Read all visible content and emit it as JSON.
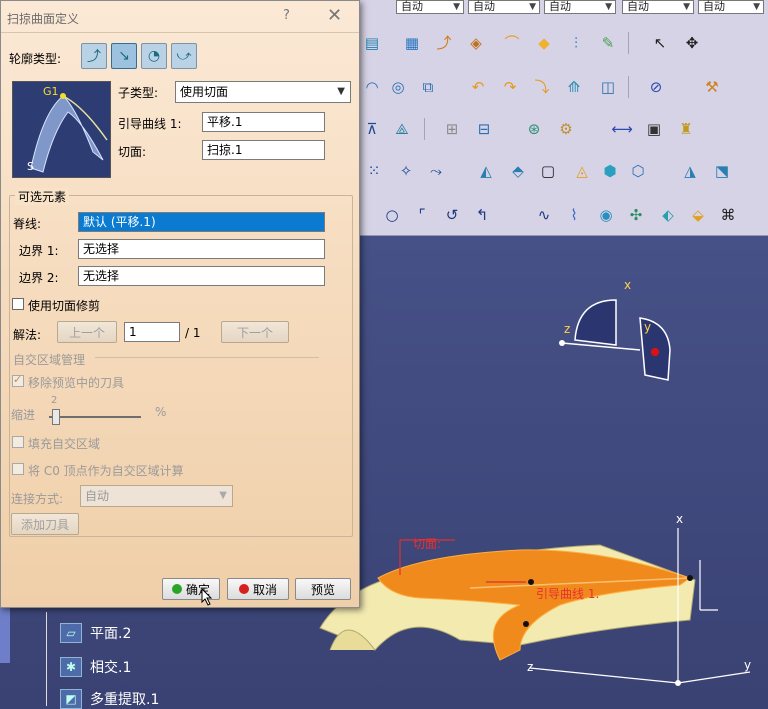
{
  "dialog": {
    "title": "扫掠曲面定义",
    "help_glyph": "?",
    "close_glyph": "✕",
    "profile_type_label": "轮廓类型:",
    "preview_labels": {
      "g1": "G1",
      "s": "S"
    },
    "subtype_label": "子类型:",
    "subtype_value": "使用切面",
    "guide_curve_label": "引导曲线 1:",
    "guide_curve_value": "平移.1",
    "tangent_surface_label": "切面:",
    "tangent_surface_value": "扫掠.1",
    "optional_group_label": "可选元素",
    "spine_label": "脊线:",
    "spine_value": "默认 (平移.1)",
    "boundary1_label": "边界 1:",
    "boundary1_value": "无选择",
    "boundary2_label": "边界 2:",
    "boundary2_value": "无选择",
    "trim_checkbox_label": "使用切面修剪",
    "solution_label": "解法:",
    "prev_button": "上一个",
    "solution_value": "1",
    "solution_total": "/ 1",
    "next_button": "下一个",
    "self_intersection_label": "自交区域管理",
    "remove_tools_label": "移除预览中的刀具",
    "setback_label": "缩进",
    "setback_value": "2",
    "setback_unit": "%",
    "fill_label": "填充自交区域",
    "c0_label": "将 C0 顶点作为自交区域计算",
    "connection_label": "连接方式:",
    "connection_value": "自动",
    "add_tool_button": "添加刀具",
    "ok_button": "确定",
    "cancel_button": "取消",
    "preview_button": "预览"
  },
  "toolbar": {
    "combos": [
      "自动",
      "自动",
      "自动",
      "自动",
      "自动"
    ]
  },
  "viewport": {
    "axis_x": "x",
    "axis_y": "y",
    "axis_z": "z",
    "tangent_surface_tag": "切面:",
    "guide_curve_tag": "引导曲线 1."
  },
  "tree": {
    "items": [
      {
        "label": "平面.2",
        "icon": "plane-icon"
      },
      {
        "label": "相交.1",
        "icon": "intersect-icon"
      },
      {
        "label": "多重提取.1",
        "icon": "extract-icon"
      }
    ]
  },
  "colors": {
    "dialog_bg": "#f6dcbf",
    "selected_field": "#0a7bd0",
    "sweep_surface": "#f08a1c",
    "tangent_surface": "#f3eab0",
    "viewport_bg": "#434d82",
    "ok_dot": "#2aa52a",
    "cancel_dot": "#d42020"
  }
}
